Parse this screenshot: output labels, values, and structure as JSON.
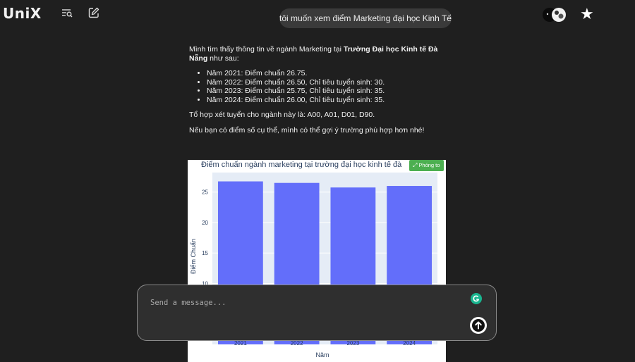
{
  "app": {
    "logo_text": "UniX"
  },
  "toolbar": {
    "history_icon": "search-history-icon",
    "new_chat_icon": "new-chat-icon",
    "favorite_icon": "star-icon"
  },
  "user_message": "tôi muốn xem điểm Marketing đại học Kinh Tế ĐN",
  "answer": {
    "intro_prefix": "Mình tìm thấy thông tin về ngành Marketing tại ",
    "intro_bold": "Trường Đại học Kinh tế Đà Nẵng",
    "intro_suffix": " như sau:",
    "items": [
      "Năm 2021: Điểm chuẩn 26.75.",
      "Năm 2022: Điểm chuẩn 26.50, Chỉ tiêu tuyển sinh: 30.",
      "Năm 2023: Điểm chuẩn 25.75, Chỉ tiêu tuyển sinh: 35.",
      "Năm 2024: Điểm chuẩn 26.00, Chỉ tiêu tuyển sinh: 35."
    ],
    "combo": "Tổ hợp xét tuyển cho ngành này là: A00, A01, D01, D90.",
    "closing": "Nếu bạn có điểm số cụ thể, mình có thể gợi ý trường phù hợp hơn nhé!"
  },
  "zoom_button": {
    "label": "Phóng to",
    "icon": "expand-icon"
  },
  "chart_data": {
    "type": "bar",
    "title": "Điểm chuẩn ngành marketing tại trường đại học kinh tế đà",
    "categories": [
      "2021",
      "2022",
      "2023",
      "2024"
    ],
    "values": [
      26.75,
      26.5,
      25.75,
      26.0
    ],
    "xlabel": "Năm",
    "ylabel": "Điểm Chuẩn",
    "yticks": [
      "10",
      "15",
      "20",
      "25"
    ],
    "ylim": [
      0,
      28.2
    ],
    "bar_color": "#636efa",
    "plot_bg": "#e5ecf6",
    "grid": true
  },
  "composer": {
    "placeholder": "Send a message...",
    "grammar_icon": "grammarly-icon",
    "send_icon": "arrow-up-icon"
  },
  "colors": {
    "background": "#1f1f1f",
    "bubble": "#3a3a3a",
    "composer": "#2f2f2f",
    "zoom": "#4caf50"
  }
}
